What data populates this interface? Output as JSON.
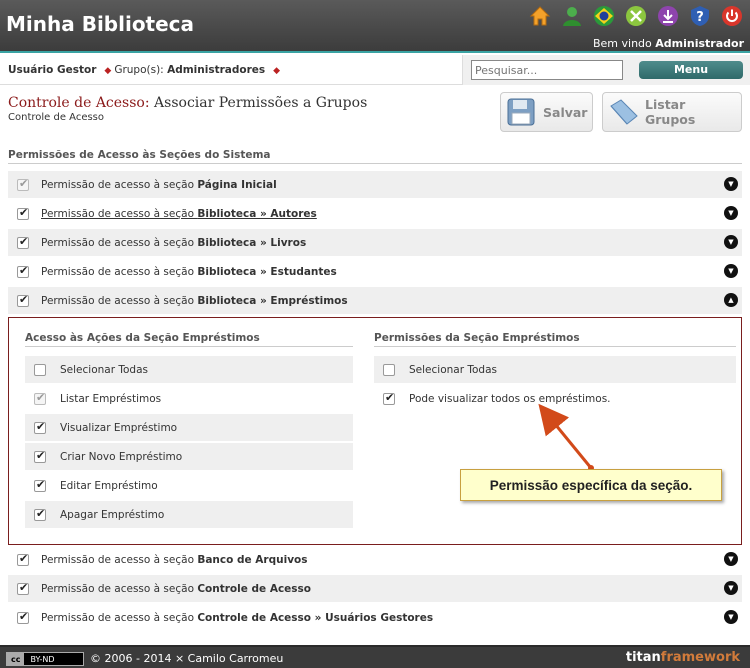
{
  "header": {
    "app_title": "Minha Biblioteca",
    "welcome_prefix": "Bem vindo",
    "welcome_user": "Administrador",
    "icons": [
      "home-icon",
      "user-icon",
      "brazil-flag-icon",
      "tools-icon",
      "download-icon",
      "help-icon",
      "power-icon"
    ]
  },
  "userbar": {
    "user_label": "Usuário Gestor",
    "groups_label": "Grupo(s):",
    "groups_value": "Administradores",
    "search_placeholder": "Pesquisar...",
    "menu_label": "Menu"
  },
  "page": {
    "title_prefix": "Controle de Acesso:",
    "title_rest": "Associar Permissões a Grupos",
    "subtitle": "Controle de Acesso",
    "save_label": "Salvar",
    "list_groups_label": "Listar Grupos",
    "section_heading": "Permissões de Acesso às Seções do Sistema"
  },
  "rows_top": [
    {
      "prefix": "Permissão de acesso à seção",
      "name": "Página Inicial",
      "checked": true,
      "disabled": true
    },
    {
      "prefix": "Permissão de acesso à seção",
      "name": "Biblioteca » Autores",
      "checked": true,
      "disabled": false
    },
    {
      "prefix": "Permissão de acesso à seção",
      "name": "Biblioteca » Livros",
      "checked": true,
      "disabled": false
    },
    {
      "prefix": "Permissão de acesso à seção",
      "name": "Biblioteca » Estudantes",
      "checked": true,
      "disabled": false
    },
    {
      "prefix": "Permissão de acesso à seção",
      "name": "Biblioteca » Empréstimos",
      "checked": true,
      "disabled": false
    }
  ],
  "panel": {
    "actions_heading": "Acesso às Ações da Seção Empréstimos",
    "actions": [
      {
        "label": "Selecionar Todas",
        "checked": false,
        "disabled": false
      },
      {
        "label": "Listar Empréstimos",
        "checked": true,
        "disabled": true
      },
      {
        "label": "Visualizar Empréstimo",
        "checked": true,
        "disabled": false
      },
      {
        "label": "Criar Novo Empréstimo",
        "checked": true,
        "disabled": false
      },
      {
        "label": "Editar Empréstimo",
        "checked": true,
        "disabled": false
      },
      {
        "label": "Apagar Empréstimo",
        "checked": true,
        "disabled": false
      }
    ],
    "perms_heading": "Permissões da Seção Empréstimos",
    "perms": [
      {
        "label": "Selecionar Todas",
        "checked": false
      },
      {
        "label": "Pode visualizar todos os empréstimos.",
        "checked": true
      }
    ],
    "callout": "Permissão específica da seção."
  },
  "rows_bottom": [
    {
      "prefix": "Permissão de acesso à seção",
      "name": "Banco de Arquivos",
      "checked": true
    },
    {
      "prefix": "Permissão de acesso à seção",
      "name": "Controle de Acesso",
      "checked": true
    },
    {
      "prefix": "Permissão de acesso à seção",
      "name": "Controle de Acesso » Usuários Gestores",
      "checked": true
    }
  ],
  "footer": {
    "cc_left": "cc",
    "cc_right": "BY-ND",
    "copyright": "© 2006 - 2014 × Camilo Carromeu",
    "brand_a": "titan",
    "brand_b": "framework"
  },
  "colors": {
    "accent": "#3aa3a3",
    "title_red": "#8b1a1a",
    "panel_border": "#7a1e1e",
    "callout_arrow": "#d24a1a"
  }
}
